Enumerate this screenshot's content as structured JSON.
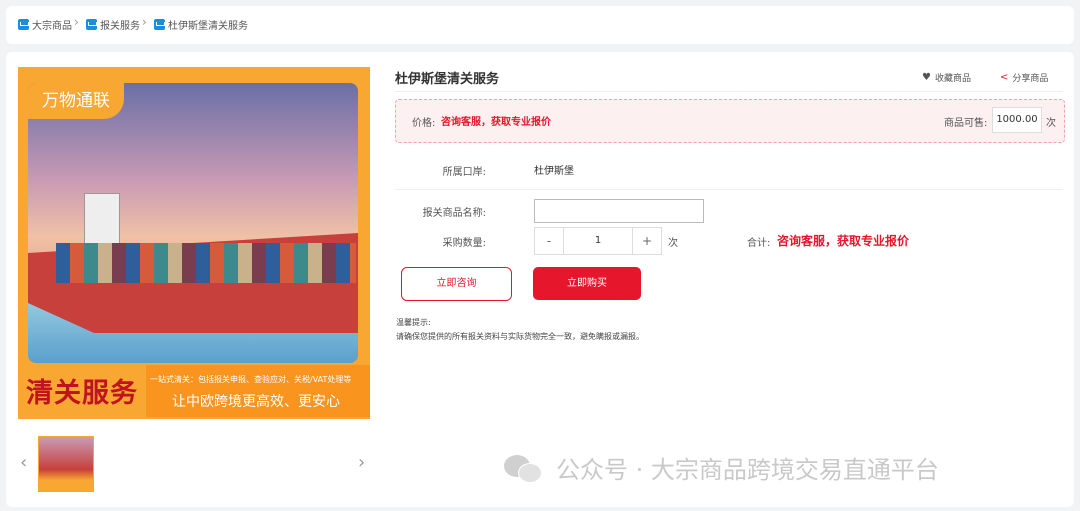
{
  "breadcrumb": {
    "items": [
      "大宗商品",
      "报关服务",
      "杜伊斯堡清关服务"
    ]
  },
  "hero": {
    "brand": "万物通联",
    "title": "清关服务",
    "small_text": "一站式清关：包括报关申报、查验应对、关税/VAT处理等",
    "subtitle": "让中欧跨境更高效、更安心",
    "thumbnail_label": "清关服务"
  },
  "product": {
    "title": "杜伊斯堡清关服务",
    "favorite_label": "收藏商品",
    "share_label": "分享商品",
    "price_label": "价格:",
    "price_value": "咨询客服，获取专业报价",
    "stock_label": "商品可售:",
    "stock_value": "1000.00",
    "stock_unit": "次",
    "port_label": "所属口岸:",
    "port_value": "杜伊斯堡",
    "name_label": "报关商品名称:",
    "name_value": "",
    "qty_label": "采购数量:",
    "qty_minus": "-",
    "qty_value": "1",
    "qty_plus": "+",
    "qty_unit": "次",
    "total_label": "合计:",
    "total_value": "咨询客服，获取专业报价",
    "consult_button": "立即咨询",
    "buy_button": "立即购买",
    "tip_title": "温馨提示:",
    "tip_text": "请确保您提供的所有报关资料与实际货物完全一致，避免瞒报或漏报。"
  },
  "watermark": "公众号 · 大宗商品跨境交易直通平台",
  "colors": {
    "accent": "#e6162d",
    "brand_orange": "#f7a732",
    "crumb_icon": "#1a8fe0"
  },
  "icons": [
    "folder-icon",
    "heart-icon",
    "share-icon",
    "chevron-left-icon",
    "chevron-right-icon",
    "wechat-icon"
  ]
}
